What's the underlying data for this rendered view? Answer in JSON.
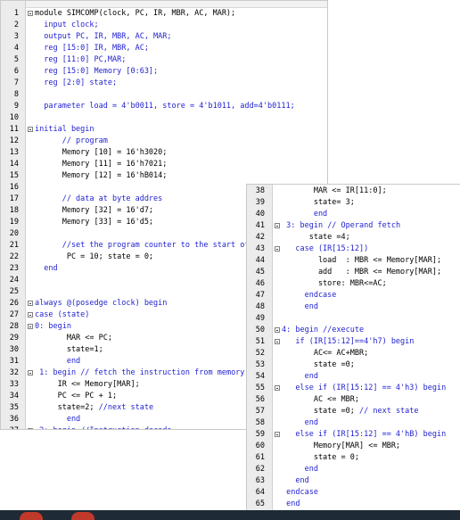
{
  "left_pane": {
    "lines": [
      {
        "n": "1",
        "fold": true,
        "segs": [
          {
            "t": "module SIMCOMP(clock, PC, IR, MBR, AC, MAR);",
            "c": "pl"
          }
        ]
      },
      {
        "n": "2",
        "segs": [
          {
            "t": "  input clock;",
            "c": "kw"
          }
        ]
      },
      {
        "n": "3",
        "segs": [
          {
            "t": "  output PC, IR, MBR, AC, MAR;",
            "c": "kw"
          }
        ]
      },
      {
        "n": "4",
        "segs": [
          {
            "t": "  reg [15:0] IR, MBR, AC;",
            "c": "kw"
          }
        ]
      },
      {
        "n": "5",
        "segs": [
          {
            "t": "  reg [11:0] PC,MAR;",
            "c": "kw"
          }
        ]
      },
      {
        "n": "6",
        "segs": [
          {
            "t": "  reg [15:0] Memory [0:63];",
            "c": "kw"
          }
        ]
      },
      {
        "n": "7",
        "segs": [
          {
            "t": "  reg [2:0] state;",
            "c": "kw"
          }
        ]
      },
      {
        "n": "8",
        "segs": [
          {
            "t": "",
            "c": "pl"
          }
        ]
      },
      {
        "n": "9",
        "segs": [
          {
            "t": "  parameter load = 4'b0011, store = 4'b1011, add=4'b0111;",
            "c": "kw"
          }
        ]
      },
      {
        "n": "10",
        "segs": [
          {
            "t": "",
            "c": "pl"
          }
        ]
      },
      {
        "n": "11",
        "fold": true,
        "segs": [
          {
            "t": "initial begin",
            "c": "kw"
          }
        ]
      },
      {
        "n": "12",
        "segs": [
          {
            "t": "      // program",
            "c": "cm"
          }
        ]
      },
      {
        "n": "13",
        "segs": [
          {
            "t": "      Memory [10] = 16'h3020;",
            "c": "pl"
          }
        ]
      },
      {
        "n": "14",
        "segs": [
          {
            "t": "      Memory [11] = 16'h7021;",
            "c": "pl"
          }
        ]
      },
      {
        "n": "15",
        "segs": [
          {
            "t": "      Memory [12] = 16'hB014;",
            "c": "pl"
          }
        ]
      },
      {
        "n": "16",
        "segs": [
          {
            "t": "",
            "c": "pl"
          }
        ]
      },
      {
        "n": "17",
        "segs": [
          {
            "t": "      // data at byte addres",
            "c": "cm"
          }
        ]
      },
      {
        "n": "18",
        "segs": [
          {
            "t": "      Memory [32] = 16'd7;",
            "c": "pl"
          }
        ]
      },
      {
        "n": "19",
        "segs": [
          {
            "t": "      Memory [33] = 16'd5;",
            "c": "pl"
          }
        ]
      },
      {
        "n": "20",
        "segs": [
          {
            "t": "",
            "c": "pl"
          }
        ]
      },
      {
        "n": "21",
        "segs": [
          {
            "t": "      //set the program counter to the start of the",
            "c": "cm"
          }
        ]
      },
      {
        "n": "22",
        "segs": [
          {
            "t": "       PC = 10; state = 0;",
            "c": "pl"
          }
        ]
      },
      {
        "n": "23",
        "segs": [
          {
            "t": "  end",
            "c": "kw"
          }
        ]
      },
      {
        "n": "24",
        "segs": [
          {
            "t": "",
            "c": "pl"
          }
        ]
      },
      {
        "n": "25",
        "segs": [
          {
            "t": "",
            "c": "pl"
          }
        ]
      },
      {
        "n": "26",
        "fold": true,
        "segs": [
          {
            "t": "always @(posedge clock) begin",
            "c": "kw"
          }
        ]
      },
      {
        "n": "27",
        "fold": true,
        "segs": [
          {
            "t": "case (state)",
            "c": "kw"
          }
        ]
      },
      {
        "n": "28",
        "fold": true,
        "segs": [
          {
            "t": "0: begin",
            "c": "kw"
          }
        ]
      },
      {
        "n": "29",
        "segs": [
          {
            "t": "       MAR <= PC;",
            "c": "pl"
          }
        ]
      },
      {
        "n": "30",
        "segs": [
          {
            "t": "       state=1;",
            "c": "pl"
          }
        ]
      },
      {
        "n": "31",
        "segs": [
          {
            "t": "       end",
            "c": "kw"
          }
        ]
      },
      {
        "n": "32",
        "fold": true,
        "segs": [
          {
            "t": " 1: begin ",
            "c": "kw"
          },
          {
            "t": "// fetch the instruction from memory",
            "c": "cm"
          }
        ]
      },
      {
        "n": "33",
        "segs": [
          {
            "t": "     IR <= Memory[MAR];",
            "c": "pl"
          }
        ]
      },
      {
        "n": "34",
        "segs": [
          {
            "t": "     PC <= PC + 1;",
            "c": "pl"
          }
        ]
      },
      {
        "n": "35",
        "segs": [
          {
            "t": "     state=2; ",
            "c": "pl"
          },
          {
            "t": "//next state",
            "c": "cm"
          }
        ]
      },
      {
        "n": "36",
        "segs": [
          {
            "t": "       end",
            "c": "kw"
          }
        ]
      },
      {
        "n": "37",
        "fold": true,
        "segs": [
          {
            "t": " 2: begin ",
            "c": "kw"
          },
          {
            "t": "//Instruction decode",
            "c": "cm"
          }
        ]
      }
    ]
  },
  "right_pane": {
    "lines": [
      {
        "n": "38",
        "segs": [
          {
            "t": "       MAR <= IR[11:0];",
            "c": "pl"
          }
        ]
      },
      {
        "n": "39",
        "segs": [
          {
            "t": "       state= 3;",
            "c": "pl"
          }
        ]
      },
      {
        "n": "40",
        "segs": [
          {
            "t": "       end",
            "c": "kw"
          }
        ]
      },
      {
        "n": "41",
        "fold": true,
        "segs": [
          {
            "t": " 3: begin ",
            "c": "kw"
          },
          {
            "t": "// Operand fetch",
            "c": "cm"
          }
        ]
      },
      {
        "n": "42",
        "segs": [
          {
            "t": "      state =4;",
            "c": "pl"
          }
        ]
      },
      {
        "n": "43",
        "fold": true,
        "segs": [
          {
            "t": "   case (IR[15:12])",
            "c": "kw"
          }
        ]
      },
      {
        "n": "44",
        "segs": [
          {
            "t": "        load  : MBR <= Memory[MAR];",
            "c": "pl"
          }
        ]
      },
      {
        "n": "45",
        "segs": [
          {
            "t": "        add   : MBR <= Memory[MAR];",
            "c": "pl"
          }
        ]
      },
      {
        "n": "46",
        "segs": [
          {
            "t": "        store: MBR<=AC;",
            "c": "pl"
          }
        ]
      },
      {
        "n": "47",
        "segs": [
          {
            "t": "     endcase",
            "c": "kw"
          }
        ]
      },
      {
        "n": "48",
        "segs": [
          {
            "t": "     end",
            "c": "kw"
          }
        ]
      },
      {
        "n": "49",
        "segs": [
          {
            "t": "",
            "c": "pl"
          }
        ]
      },
      {
        "n": "50",
        "fold": true,
        "segs": [
          {
            "t": "4: begin ",
            "c": "kw"
          },
          {
            "t": "//execute",
            "c": "cm"
          }
        ]
      },
      {
        "n": "51",
        "fold": true,
        "segs": [
          {
            "t": "   if (IR[15:12]==4'h7) begin",
            "c": "kw"
          }
        ]
      },
      {
        "n": "52",
        "segs": [
          {
            "t": "       AC<= AC+MBR;",
            "c": "pl"
          }
        ]
      },
      {
        "n": "53",
        "segs": [
          {
            "t": "       state =0;",
            "c": "pl"
          }
        ]
      },
      {
        "n": "54",
        "segs": [
          {
            "t": "     end",
            "c": "kw"
          }
        ]
      },
      {
        "n": "55",
        "fold": true,
        "segs": [
          {
            "t": "   else if (IR[15:12] == 4'h3) begin",
            "c": "kw"
          }
        ]
      },
      {
        "n": "56",
        "segs": [
          {
            "t": "       AC <= MBR;",
            "c": "pl"
          }
        ]
      },
      {
        "n": "57",
        "segs": [
          {
            "t": "       state =0; ",
            "c": "pl"
          },
          {
            "t": "// next state",
            "c": "cm"
          }
        ]
      },
      {
        "n": "58",
        "segs": [
          {
            "t": "     end",
            "c": "kw"
          }
        ]
      },
      {
        "n": "59",
        "fold": true,
        "segs": [
          {
            "t": "   else if (IR[15:12] == 4'hB) begin",
            "c": "kw"
          }
        ]
      },
      {
        "n": "60",
        "segs": [
          {
            "t": "       Memory[MAR] <= MBR;",
            "c": "pl"
          }
        ]
      },
      {
        "n": "61",
        "segs": [
          {
            "t": "       state = 0;",
            "c": "pl"
          }
        ]
      },
      {
        "n": "62",
        "segs": [
          {
            "t": "     end",
            "c": "kw"
          }
        ]
      },
      {
        "n": "63",
        "segs": [
          {
            "t": "   end",
            "c": "kw"
          }
        ]
      },
      {
        "n": "64",
        "segs": [
          {
            "t": " endcase",
            "c": "kw"
          }
        ]
      },
      {
        "n": "65",
        "segs": [
          {
            "t": " end",
            "c": "kw"
          }
        ]
      }
    ]
  },
  "colors": {
    "keyword": "#1f1fd0",
    "plain": "#000000",
    "gutter": "#ececec",
    "taskbar": "#1e2a36"
  },
  "taskbar": {
    "buttons": [
      {
        "name": "taskbar-app-1",
        "color": "#c0392b"
      },
      {
        "name": "taskbar-app-2",
        "color": "#c0392b"
      }
    ]
  }
}
